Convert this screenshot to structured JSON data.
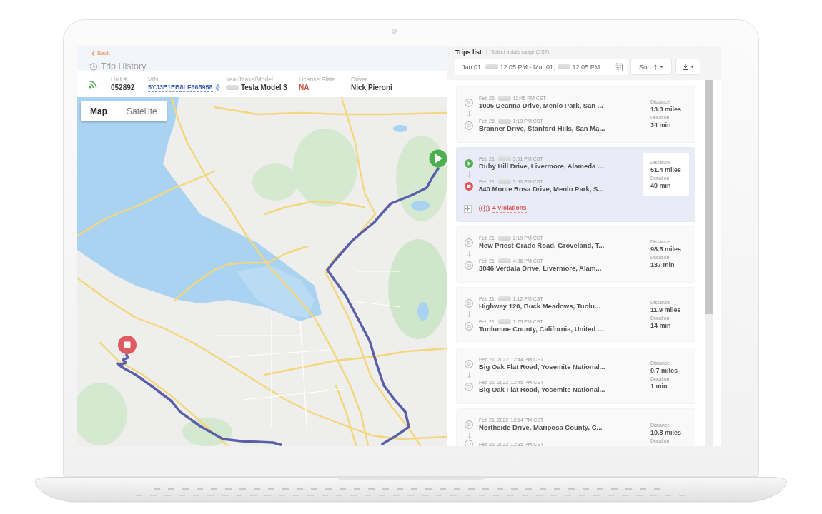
{
  "header": {
    "back_link": "Back",
    "title": "Trip History"
  },
  "vehicle_fields": [
    {
      "label": "Unit #",
      "value": "052892",
      "kind": "text"
    },
    {
      "label": "VIN",
      "value": "5YJ3E1EB8LF665958",
      "kind": "link"
    },
    {
      "label": "Year/Make/Model",
      "value": "Tesla Model 3",
      "kind": "redacted"
    },
    {
      "label": "License Plate",
      "value": "NA",
      "kind": "alert"
    },
    {
      "label": "Driver",
      "value": "Nick Pieroni",
      "kind": "text"
    }
  ],
  "map": {
    "view_tabs": [
      {
        "label": "Map",
        "selected": true
      },
      {
        "label": "Satellite",
        "selected": false
      }
    ]
  },
  "trips_panel": {
    "title": "Trips list",
    "hint": "Select a date range (CST)",
    "date_range": {
      "year_redacted": true,
      "start_date": "Jan 01,",
      "start_time": "12:05 PM",
      "separator": "-",
      "end_date": "Mar 01,",
      "end_time": "12:05 PM"
    },
    "sort_button": "Sort"
  },
  "trips": [
    {
      "selected": false,
      "start": {
        "date": "Feb 26,",
        "year_redacted": true,
        "time": "12:46 PM CST",
        "address": "1005 Deanna Drive, Menlo Park, San ..."
      },
      "end": {
        "date": "Feb 26,",
        "year_redacted": true,
        "time": "1:19 PM CST",
        "address": "Branner Drive, Stanford Hills, San Ma..."
      },
      "distance_label": "Distance",
      "distance": "13.3 miles",
      "duration_label": "Duration",
      "duration": "34 min"
    },
    {
      "selected": true,
      "start": {
        "date": "Feb 21,",
        "year_redacted": true,
        "time": "5:01 PM CST",
        "address": "Ruby Hill Drive, Livermore, Alameda ..."
      },
      "end": {
        "date": "Feb 21,",
        "year_redacted": true,
        "time": "5:50 PM CST",
        "address": "840 Monte Rosa Drive, Menlo Park, S..."
      },
      "distance_label": "Distance",
      "distance": "51.4 miles",
      "duration_label": "Duration",
      "duration": "49 min",
      "violations": {
        "label": "4 Violations",
        "expanded": false
      }
    },
    {
      "selected": false,
      "start": {
        "date": "Feb 21,",
        "year_redacted": true,
        "time": "2:19 PM CST",
        "address": "New Priest Grade Road, Groveland, T..."
      },
      "end": {
        "date": "Feb 21,",
        "year_redacted": true,
        "time": "4:36 PM CST",
        "address": "3046 Verdala Drive, Livermore, Alam..."
      },
      "distance_label": "Distance",
      "distance": "98.5 miles",
      "duration_label": "Duration",
      "duration": "137 min"
    },
    {
      "selected": false,
      "start": {
        "date": "Feb 21,",
        "year_redacted": true,
        "time": "1:12 PM CST",
        "address": "Highway 120, Buck Meadows, Tuolu..."
      },
      "end": {
        "date": "Feb 21,",
        "year_redacted": true,
        "time": "1:25 PM CST",
        "address": "Tuolumne County, California, United ..."
      },
      "distance_label": "Distance",
      "distance": "11.9 miles",
      "duration_label": "Duration",
      "duration": "14 min"
    },
    {
      "selected": false,
      "start": {
        "date": "Feb 21, 2022",
        "year_redacted": false,
        "time": "12:44 PM CST",
        "address": "Big Oak Flat Road, Yosemite National..."
      },
      "end": {
        "date": "Feb 21, 2022",
        "year_redacted": false,
        "time": "12:45 PM CST",
        "address": "Big Oak Flat Road, Yosemite National..."
      },
      "distance_label": "Distance",
      "distance": "0.7 miles",
      "duration_label": "Duration",
      "duration": "1 min"
    },
    {
      "selected": false,
      "start": {
        "date": "Feb 21, 2022",
        "year_redacted": false,
        "time": "12:14 PM CST",
        "address": "Northside Drive, Mariposa County, C..."
      },
      "end": {
        "date": "Feb 21, 2022",
        "year_redacted": false,
        "time": "12:35 PM CST"
      },
      "distance_label": "Distance",
      "distance": "10.8 miles",
      "duration_label": "Duration"
    }
  ]
}
